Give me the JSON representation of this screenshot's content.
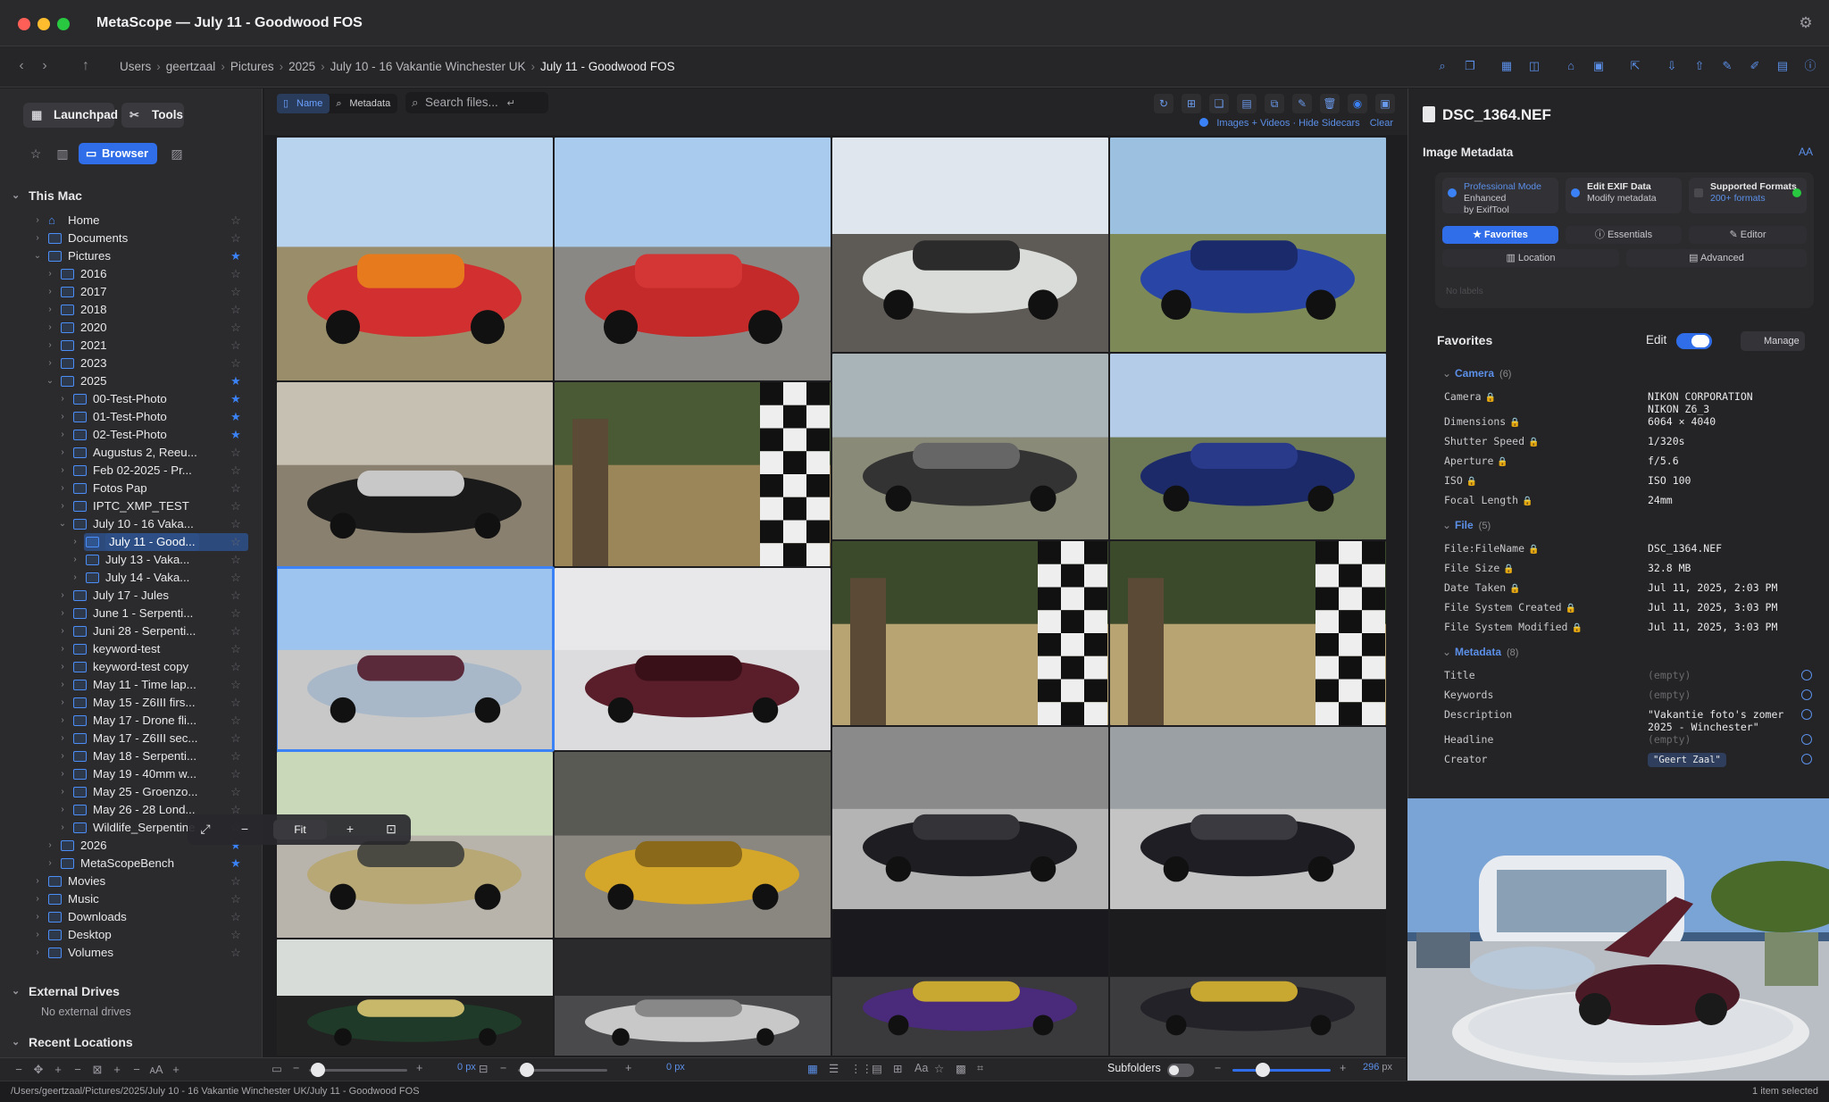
{
  "window": {
    "title": "MetaScope — July 11 - Goodwood FOS"
  },
  "breadcrumb": [
    "Users",
    "geertzaal",
    "Pictures",
    "2025",
    "July 10 - 16 Vakantie Winchester UK",
    "July 11 - Goodwood FOS"
  ],
  "sidebar": {
    "launchpad_label": "Launchpad",
    "tools_label": "Tools",
    "browser_label": "Browser",
    "sections": {
      "this_mac": "This Mac",
      "external": "External Drives",
      "recent": "Recent Locations"
    },
    "no_external": "No external drives",
    "items": [
      {
        "label": "Home",
        "depth": 0,
        "starred": false,
        "open": false,
        "type": "home"
      },
      {
        "label": "Documents",
        "depth": 0,
        "starred": false,
        "open": false
      },
      {
        "label": "Pictures",
        "depth": 0,
        "starred": true,
        "open": true
      },
      {
        "label": "2016",
        "depth": 1,
        "starred": false
      },
      {
        "label": "2017",
        "depth": 1,
        "starred": false
      },
      {
        "label": "2018",
        "depth": 1,
        "starred": false
      },
      {
        "label": "2020",
        "depth": 1,
        "starred": false
      },
      {
        "label": "2021",
        "depth": 1,
        "starred": false
      },
      {
        "label": "2023",
        "depth": 1,
        "starred": false
      },
      {
        "label": "2025",
        "depth": 1,
        "starred": true,
        "open": true
      },
      {
        "label": "00-Test-Photo",
        "depth": 2,
        "starred": true
      },
      {
        "label": "01-Test-Photo",
        "depth": 2,
        "starred": true
      },
      {
        "label": "02-Test-Photo",
        "depth": 2,
        "starred": true
      },
      {
        "label": "Augustus 2, Reeu...",
        "depth": 2,
        "starred": false
      },
      {
        "label": "Feb 02-2025 - Pr...",
        "depth": 2,
        "starred": false
      },
      {
        "label": "Fotos Pap",
        "depth": 2,
        "starred": false
      },
      {
        "label": "IPTC_XMP_TEST",
        "depth": 2,
        "starred": false
      },
      {
        "label": "July 10 - 16 Vaka...",
        "depth": 2,
        "starred": false,
        "open": true
      },
      {
        "label": "July 11 - Good...",
        "depth": 3,
        "starred": false,
        "selected": true
      },
      {
        "label": "July 13 - Vaka...",
        "depth": 3,
        "starred": false
      },
      {
        "label": "July 14 - Vaka...",
        "depth": 3,
        "starred": false
      },
      {
        "label": "July 17 - Jules",
        "depth": 2,
        "starred": false
      },
      {
        "label": "June 1 - Serpenti...",
        "depth": 2,
        "starred": false
      },
      {
        "label": "Juni 28 - Serpenti...",
        "depth": 2,
        "starred": false
      },
      {
        "label": "keyword-test",
        "depth": 2,
        "starred": false
      },
      {
        "label": "keyword-test copy",
        "depth": 2,
        "starred": false
      },
      {
        "label": "May 11 - Time lap...",
        "depth": 2,
        "starred": false
      },
      {
        "label": "May 15 - Z6III firs...",
        "depth": 2,
        "starred": false
      },
      {
        "label": "May 17 - Drone fli...",
        "depth": 2,
        "starred": false
      },
      {
        "label": "May 17 - Z6III sec...",
        "depth": 2,
        "starred": false
      },
      {
        "label": "May 18 - Serpenti...",
        "depth": 2,
        "starred": false
      },
      {
        "label": "May 19 - 40mm w...",
        "depth": 2,
        "starred": false
      },
      {
        "label": "May 25 - Groenzo...",
        "depth": 2,
        "starred": false
      },
      {
        "label": "May 26 - 28 Lond...",
        "depth": 2,
        "starred": false
      },
      {
        "label": "Wildlife_Serpentine",
        "depth": 2,
        "starred": false
      },
      {
        "label": "2026",
        "depth": 1,
        "starred": true
      },
      {
        "label": "MetaScopeBench",
        "depth": 1,
        "starred": true
      },
      {
        "label": "Movies",
        "depth": 0,
        "starred": false
      },
      {
        "label": "Music",
        "depth": 0,
        "starred": false
      },
      {
        "label": "Downloads",
        "depth": 0,
        "starred": false
      },
      {
        "label": "Desktop",
        "depth": 0,
        "starred": false
      },
      {
        "label": "Volumes",
        "depth": 0,
        "starred": false
      }
    ]
  },
  "browser": {
    "seg_name": "Name",
    "seg_metadata": "Metadata",
    "search_placeholder": "Search files...",
    "filter_text": "Images + Videos · Hide Sidecars",
    "clear_label": "Clear",
    "subfolders_label": "Subfolders",
    "thumb_size": "296",
    "thumb_size_unit": "px",
    "spacing_value": "0",
    "spacing_unit": "px",
    "padding_value": "0",
    "padding_unit": "px",
    "thumbnails": [
      {
        "name": "orange-red-ferrari-f40",
        "sky": "#b8d3ee",
        "ground": "#9a8e6a",
        "car": "#d23030",
        "car2": "#e67a1c",
        "h": 272
      },
      {
        "name": "red-cars-paddock",
        "sky": "#a9cbee",
        "ground": "#8a8884",
        "car": "#c42a2a",
        "car2": "#d43535",
        "h": 272
      },
      {
        "name": "bmw-concept-white",
        "sky": "#dfe6ee",
        "ground": "#5e5a56",
        "car": "#d9dcd8",
        "car2": "#2b2b2b",
        "h": 240
      },
      {
        "name": "blue-bentley-suv",
        "sky": "#9cc0e0",
        "ground": "#7d8a58",
        "car": "#2946a6",
        "car2": "#1a2a6a",
        "h": 240
      },
      {
        "name": "tag-heuer-grandstand",
        "sky": "#c6c0b2",
        "ground": "#8a8070",
        "car": "#1a1a1a",
        "car2": "#c8c8c8",
        "h": 206
      },
      {
        "name": "chequered-flag-trees",
        "sky": "#4a5a34",
        "ground": "#9a8658",
        "car": "#111111",
        "car2": "#eeeeee",
        "h": 206
      },
      {
        "name": "rolls-royce-crowd",
        "sky": "#a8b4b8",
        "ground": "#8a8a78",
        "car": "#333333",
        "car2": "#666666",
        "h": 208
      },
      {
        "name": "blue-rolls-royce",
        "sky": "#b4cce8",
        "ground": "#6e7a56",
        "car": "#1c2a6a",
        "car2": "#2a3a8a",
        "h": 208
      },
      {
        "name": "silver-hypercar-stand",
        "sky": "#9cc4ee",
        "ground": "#c8c8c8",
        "car": "#a8b8c8",
        "car2": "#5a2a3a",
        "h": 204,
        "selected": true
      },
      {
        "name": "pagani-utopia-burgundy",
        "sky": "#e8e8ea",
        "ground": "#dcdcde",
        "car": "#5a1e2a",
        "car2": "#3a1018",
        "h": 204
      },
      {
        "name": "chequered-flag-straw",
        "sky": "#3a4a2a",
        "ground": "#b8a472",
        "car": "#111111",
        "car2": "#eeeeee",
        "h": 206
      },
      {
        "name": "chequered-flag-straw-2",
        "sky": "#3a4a2a",
        "ground": "#b8a472",
        "car": "#111111",
        "car2": "#eeeeee",
        "h": 206
      },
      {
        "name": "lancia-prototipo-gold",
        "sky": "#c8d8b8",
        "ground": "#b8b4ac",
        "car": "#b8a876",
        "car2": "#4a4a42",
        "h": 208
      },
      {
        "name": "yellow-ferrari-tent",
        "sky": "#5a5a54",
        "ground": "#8a8680",
        "car": "#d4a62a",
        "car2": "#8a6a1a",
        "h": 208
      },
      {
        "name": "black-mclaren-front",
        "sky": "#8a8a8a",
        "ground": "#b4b4b4",
        "car": "#1e1e22",
        "car2": "#333338",
        "h": 204
      },
      {
        "name": "black-mclaren-side",
        "sky": "#9aa0a4",
        "ground": "#c4c4c4",
        "car": "#1e1e24",
        "car2": "#3a3a40",
        "h": 204
      },
      {
        "name": "zenvo-green-stand",
        "sky": "#d8dcd8",
        "ground": "#222222",
        "car": "#1f3a28",
        "car2": "#c8b86a",
        "h": 140
      },
      {
        "name": "white-car-gullwing",
        "sky": "#2a2a2c",
        "ground": "#4a4a4c",
        "car": "#c8c8c8",
        "car2": "#888888",
        "h": 140
      },
      {
        "name": "purple-pagani-display",
        "sky": "#1a1a1e",
        "ground": "#3a3a3c",
        "car": "#4a2a7a",
        "car2": "#c8a830",
        "h": 164
      },
      {
        "name": "black-pagani-display",
        "sky": "#1c1c1e",
        "ground": "#3c3c3e",
        "car": "#222228",
        "car2": "#c8a830",
        "h": 164
      }
    ]
  },
  "inspector": {
    "file_name": "DSC_1364.NEF",
    "image_metadata_title": "Image Metadata",
    "aa_label": "AA",
    "features": [
      {
        "title": "Professional Mode",
        "l2": "Enhanced",
        "l3": "by ExifTool"
      },
      {
        "title": "Edit EXIF Data",
        "l2": "Modify metadata",
        "l3": ""
      },
      {
        "title": "Supported Formats",
        "l2": "200+ formats",
        "l3": ""
      }
    ],
    "tabs": {
      "favorites": "Favorites",
      "essentials": "Essentials",
      "editor": "Editor",
      "location": "Location",
      "advanced": "Advanced"
    },
    "no_labels": "No labels",
    "favorites_title": "Favorites",
    "edit_label": "Edit",
    "manage_label": "Manage",
    "groups": {
      "camera": {
        "label": "Camera",
        "count": "(6)"
      },
      "file": {
        "label": "File",
        "count": "(5)"
      },
      "metadata": {
        "label": "Metadata",
        "count": "(8)"
      }
    },
    "camera_rows": [
      {
        "key": "Camera",
        "value": "NIKON CORPORATION\nNIKON Z6_3"
      },
      {
        "key": "Dimensions",
        "value": "6064 × 4040"
      },
      {
        "key": "Shutter Speed",
        "value": "1/320s"
      },
      {
        "key": "Aperture",
        "value": "f/5.6"
      },
      {
        "key": "ISO",
        "value": "ISO 100"
      },
      {
        "key": "Focal Length",
        "value": "24mm"
      }
    ],
    "file_rows": [
      {
        "key": "File:FileName",
        "value": "DSC_1364.NEF"
      },
      {
        "key": "File Size",
        "value": "32.8 MB"
      },
      {
        "key": "Date Taken",
        "value": "Jul 11, 2025, 2:03 PM"
      },
      {
        "key": "File System Created",
        "value": "Jul 11, 2025, 3:03 PM"
      },
      {
        "key": "File System Modified",
        "value": "Jul 11, 2025, 3:03 PM"
      }
    ],
    "metadata_rows": [
      {
        "key": "Title",
        "value": "(empty)"
      },
      {
        "key": "Keywords",
        "value": "(empty)"
      },
      {
        "key": "Description",
        "value": "\"Vakantie foto's zomer\n2025 - Winchester\""
      },
      {
        "key": "Headline",
        "value": "(empty)"
      },
      {
        "key": "Creator",
        "value": "\"Geert Zaal\""
      }
    ],
    "preview_fit_label": "Fit"
  },
  "status": {
    "path": "/Users/geertzaal/Pictures/2025/July 10 - 16 Vakantie Winchester UK/July 11 - Goodwood FOS",
    "selection": "1 item selected"
  }
}
